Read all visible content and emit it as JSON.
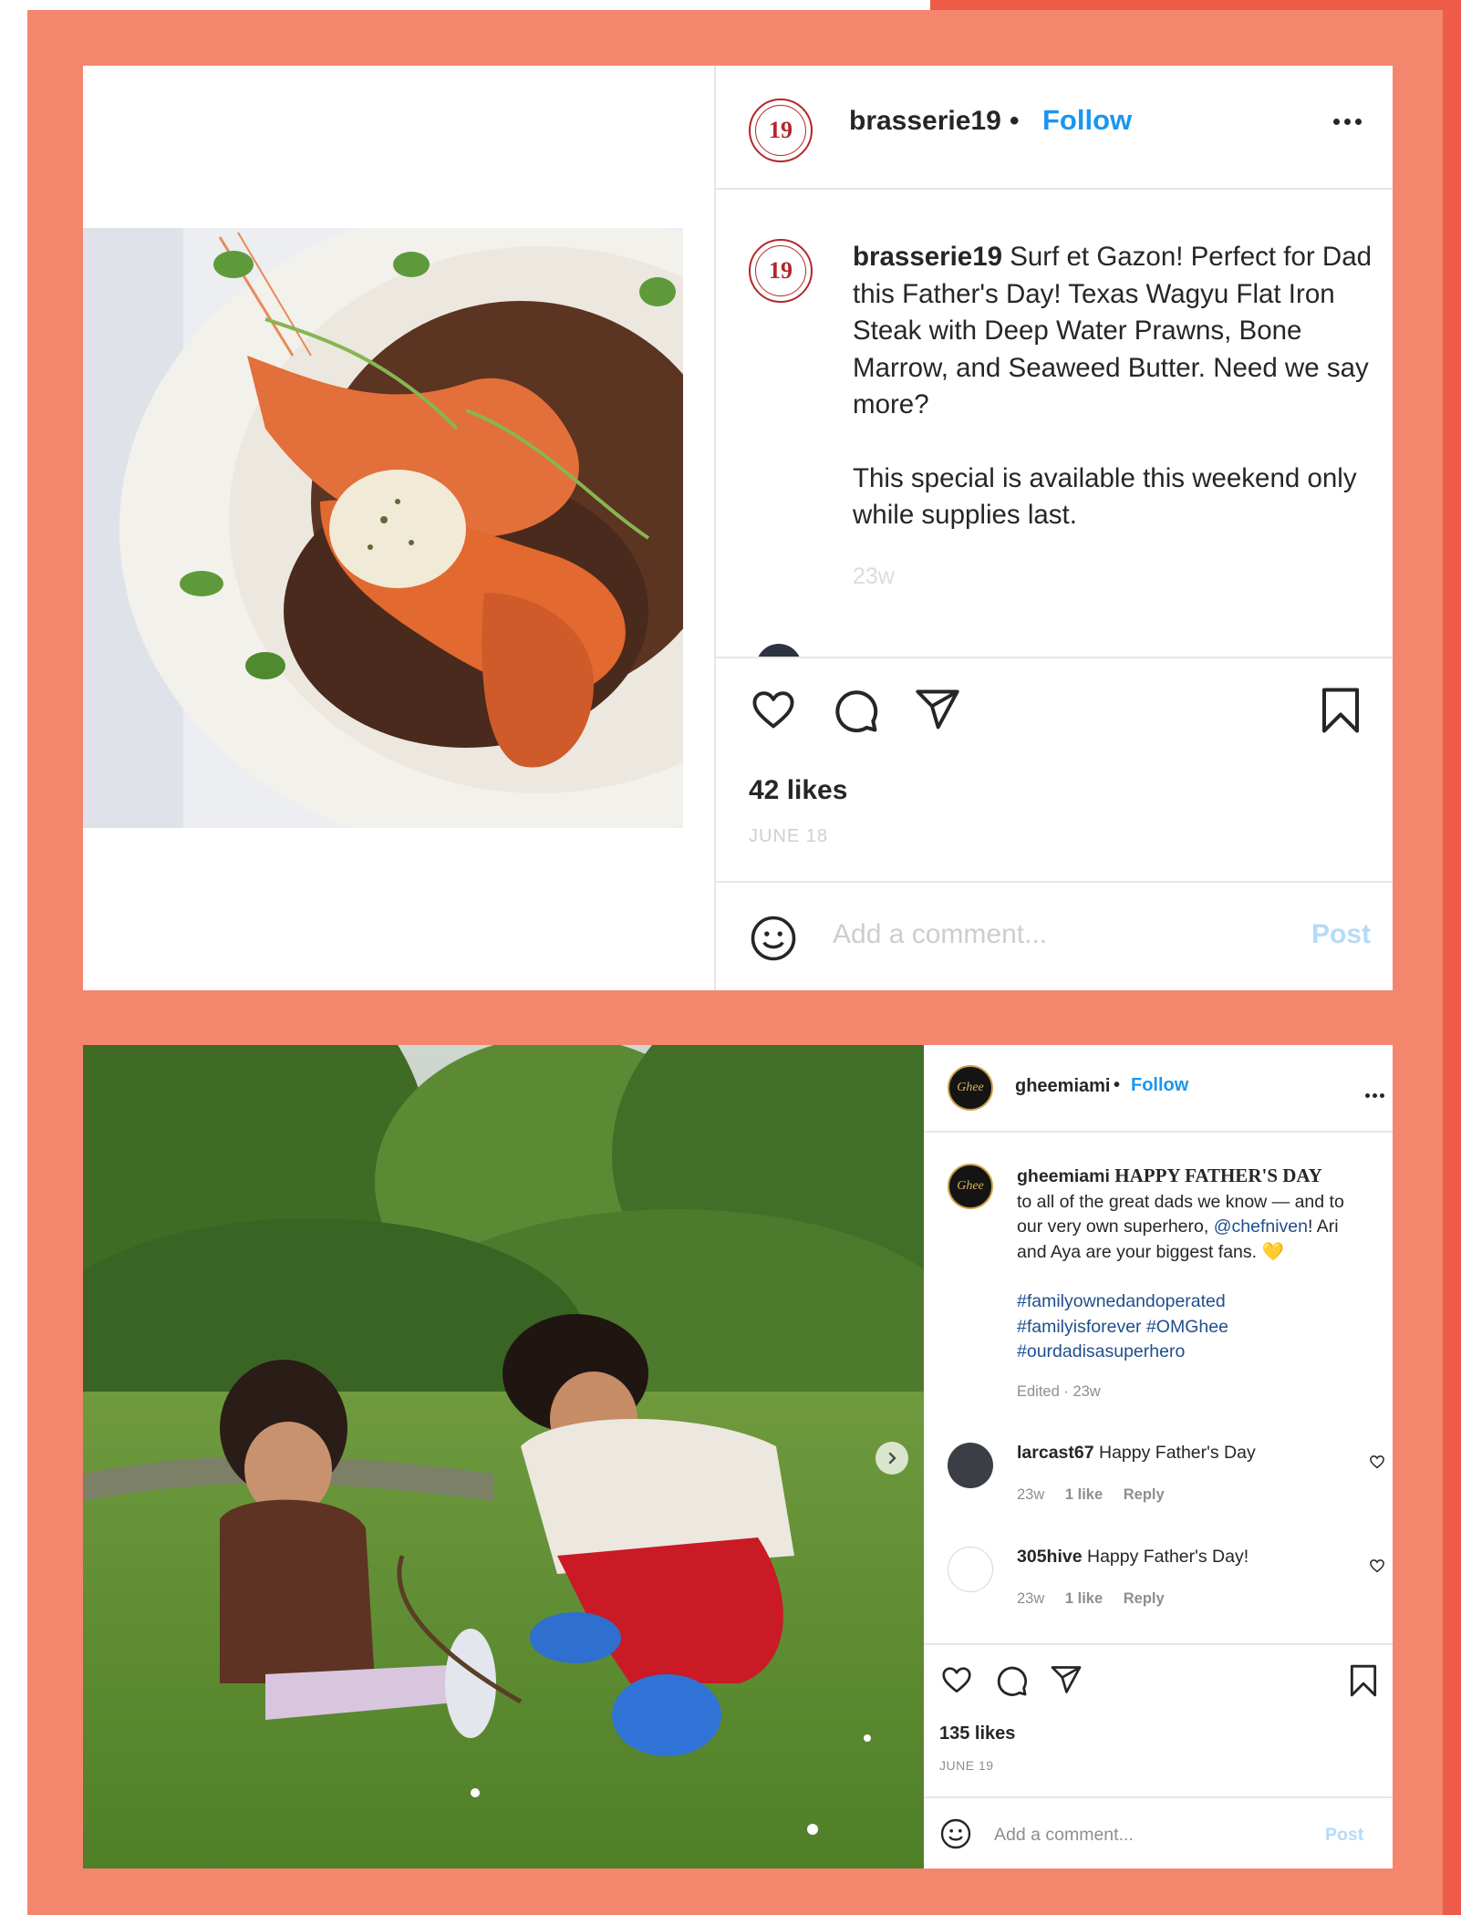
{
  "colors": {
    "background": "#f4866d",
    "accent": "#ef5b49",
    "follow": "#1a96f0",
    "post_disabled": "#b5dbf8"
  },
  "post1": {
    "username": "brasserie19",
    "separator": "•",
    "follow": "Follow",
    "avatar_text": "19",
    "caption_user": "brasserie19",
    "caption_text": " Surf et Gazon! Perfect for Dad this Father's Day! Texas Wagyu Flat Iron Steak with Deep Water Prawns, Bone Marrow, and Seaweed Butter. Need we say more?",
    "caption_text2": "This special is available this weekend only while supplies last.",
    "time": "23w",
    "likes": "42 likes",
    "date": "JUNE 18",
    "comment_placeholder": "Add a comment...",
    "post_button": "Post",
    "icons": [
      "heart-icon",
      "comment-icon",
      "share-icon",
      "bookmark-icon",
      "emoji-icon",
      "more-icon"
    ]
  },
  "post2": {
    "username": "gheemiami",
    "separator": "•",
    "follow": "Follow",
    "avatar_text": "Ghee",
    "caption_user": "gheemiami",
    "caption_headline": "HAPPY FATHER'S DAY",
    "caption_line_a": "to all of the great dads we know — and to our very own superhero, ",
    "caption_mention": "@chefniven",
    "caption_line_b": "! Ari and Aya are your biggest fans. 💛",
    "hashtags_1": "#familyownedandoperated",
    "hashtags_2": "#familyisforever #OMGhee",
    "hashtags_3": "#ourdadisasuperhero",
    "edited": "Edited · 23w",
    "comments": [
      {
        "user": "larcast67",
        "text": " Happy Father's Day",
        "time": "23w",
        "likes": "1 like",
        "reply": "Reply"
      },
      {
        "user": "305hive",
        "text": " Happy Father's Day!",
        "time": "23w",
        "likes": "1 like",
        "reply": "Reply"
      }
    ],
    "likes": "135 likes",
    "date": "JUNE 19",
    "comment_placeholder": "Add a comment...",
    "post_button": "Post",
    "icons": [
      "heart-icon",
      "comment-icon",
      "share-icon",
      "bookmark-icon",
      "emoji-icon",
      "more-icon",
      "chevron-right-icon"
    ]
  }
}
